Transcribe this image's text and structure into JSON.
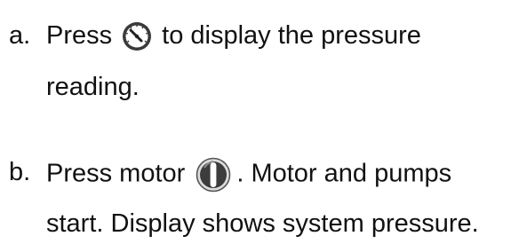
{
  "steps": [
    {
      "marker": "a.",
      "before": "Press",
      "icon": "pressure-gauge-icon",
      "after": "to display the pressure",
      "continuation": "reading."
    },
    {
      "marker": "b.",
      "before": "Press motor",
      "icon": "motor-power-button-icon",
      "after": ". Motor and pumps",
      "continuation": "start. Display shows system pressure."
    }
  ]
}
